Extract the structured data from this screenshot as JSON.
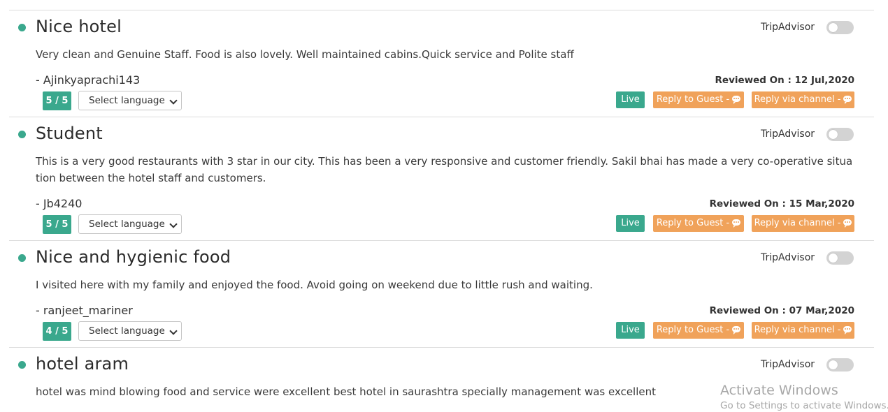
{
  "reviews": [
    {
      "title": "Nice hotel",
      "channel": "TripAdvisor",
      "text": "Very clean and Genuine Staff. Food is also lovely. Well maintained cabins.Quick service and Polite staff",
      "author": "- Ajinkyaprachi143",
      "reviewed_on": "Reviewed On : 12 Jul,2020",
      "rating": "5 / 5",
      "language_select": "Select language",
      "live_label": "Live",
      "reply_guest_label": "Reply to Guest -",
      "reply_channel_label": "Reply via channel -"
    },
    {
      "title": "Student",
      "channel": "TripAdvisor",
      "text": "This is a very good restaurants with 3 star in our city. This has been a very responsive and customer friendly. Sakil bhai has made a very co-operative situation between the hotel staff and customers.",
      "author": "- Jb4240",
      "reviewed_on": "Reviewed On : 15 Mar,2020",
      "rating": "5 / 5",
      "language_select": "Select language",
      "live_label": "Live",
      "reply_guest_label": "Reply to Guest -",
      "reply_channel_label": "Reply via channel -"
    },
    {
      "title": "Nice and hygienic food",
      "channel": "TripAdvisor",
      "text": "I visited here with my family and enjoyed the food. Avoid going on weekend due to little rush and waiting.",
      "author": "- ranjeet_mariner",
      "reviewed_on": "Reviewed On : 07 Mar,2020",
      "rating": "4 / 5",
      "language_select": "Select language",
      "live_label": "Live",
      "reply_guest_label": "Reply to Guest -",
      "reply_channel_label": "Reply via channel -"
    },
    {
      "title": "hotel aram",
      "channel": "TripAdvisor",
      "text": "hotel was mind blowing food and service were excellent best hotel in saurashtra specially management was excellent"
    }
  ],
  "accent_color": "#3aa88d",
  "button_color": "#f0a25a",
  "watermark": {
    "title": "Activate Windows",
    "subtitle": "Go to Settings to activate Windows."
  }
}
